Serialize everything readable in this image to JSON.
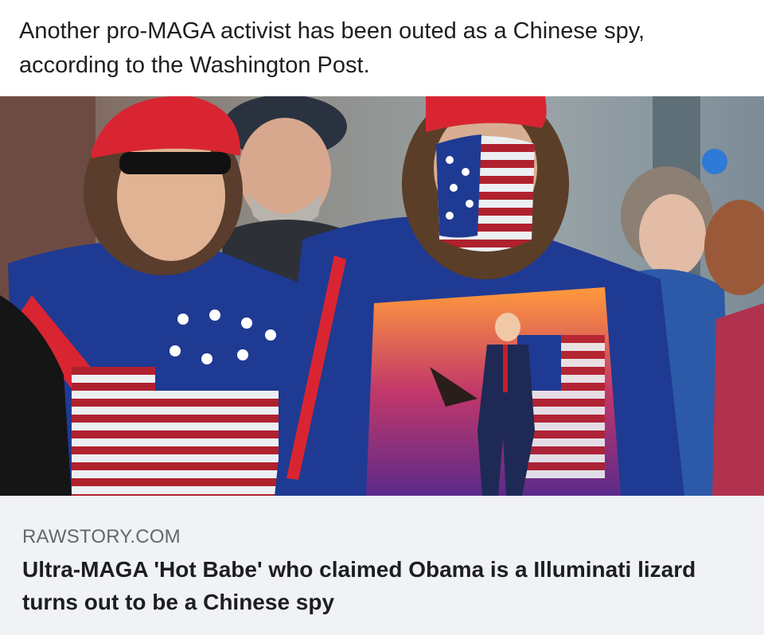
{
  "post": {
    "text": "Another pro-MAGA activist has been outed as a Chinese spy, according to the Washington Post."
  },
  "photo": {
    "subject": "two-men-in-maga-hats-wearing-american-flag-capes"
  },
  "link_preview": {
    "domain": "RAWSTORY.COM",
    "title": "Ultra-MAGA 'Hot Babe' who claimed Obama is a Illuminati lizard turns out to be a Chinese spy"
  },
  "colors": {
    "text_primary": "#1c1e21",
    "text_secondary": "#65676b",
    "card_background": "#f0f2f5",
    "maga_red": "#d92532",
    "flag_blue": "#1f3a93"
  }
}
